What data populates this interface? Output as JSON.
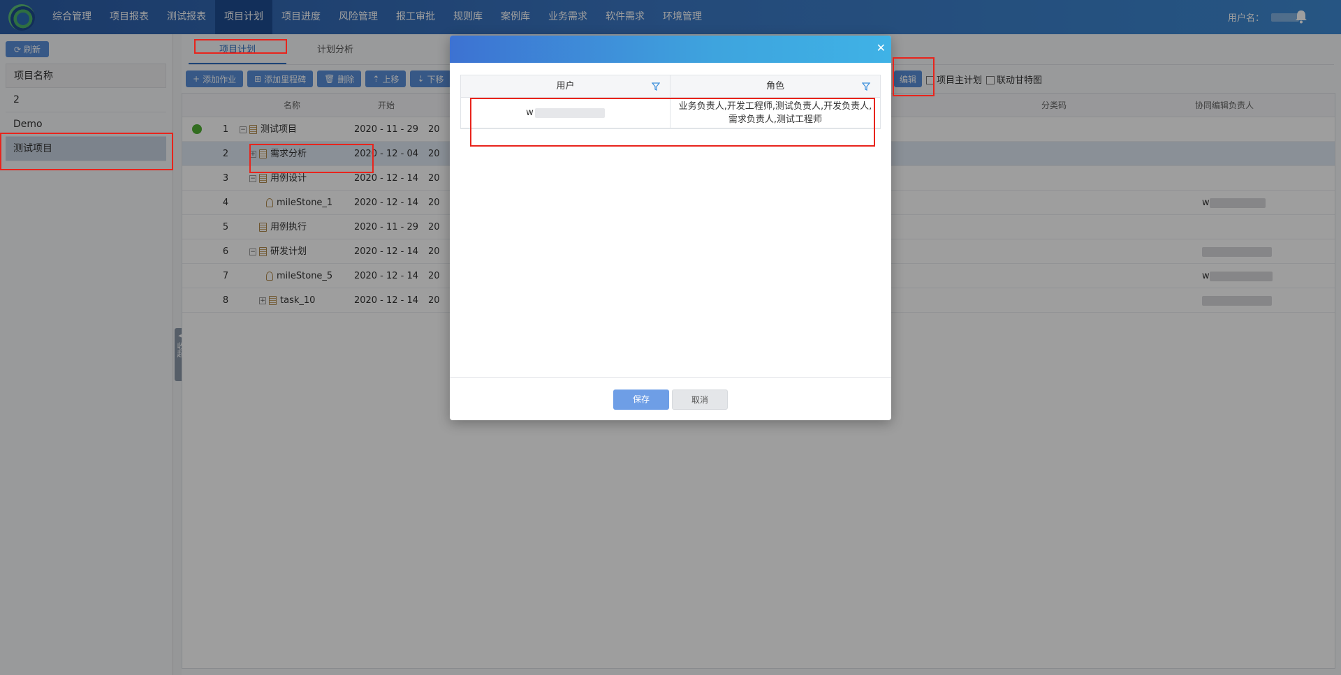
{
  "nav": {
    "items": [
      "综合管理",
      "项目报表",
      "测试报表",
      "项目计划",
      "项目进度",
      "风险管理",
      "报工审批",
      "规则库",
      "案例库",
      "业务需求",
      "软件需求",
      "环境管理"
    ],
    "active_index": 3,
    "user_label": "用户名："
  },
  "left": {
    "refresh_label": "刷新",
    "projects_header": "项目名称",
    "projects": [
      "2",
      "Demo",
      "测试项目"
    ],
    "collapse_label": "收起"
  },
  "tabs": [
    "项目计划",
    "计划分析"
  ],
  "toolbar": {
    "add_task": "添加作业",
    "add_milestone": "添加里程碑",
    "delete": "删除",
    "move_up": "上移",
    "move_down": "下移",
    "collab_edit": "编辑",
    "main_plan": "项目主计划",
    "link_gantt": "联动甘特图"
  },
  "grid": {
    "headers": {
      "name": "名称",
      "start": "开始",
      "code": "分类码",
      "assist": "协同编辑负责人"
    },
    "rows": [
      {
        "no": "1",
        "name": "测试项目",
        "start": "2020 - 11 - 29",
        "end": "20"
      },
      {
        "no": "2",
        "name": "需求分析",
        "start": "2020 - 12 - 04",
        "end": "20"
      },
      {
        "no": "3",
        "name": "用例设计",
        "start": "2020 - 12 - 14",
        "end": "20"
      },
      {
        "no": "4",
        "name": "mileStone_1",
        "start": "2020 - 12 - 14",
        "end": "20",
        "assist": "w"
      },
      {
        "no": "5",
        "name": "用例执行",
        "start": "2020 - 11 - 29",
        "end": "20"
      },
      {
        "no": "6",
        "name": "研发计划",
        "start": "2020 - 12 - 14",
        "end": "20"
      },
      {
        "no": "7",
        "name": "mileStone_5",
        "start": "2020 - 12 - 14",
        "end": "20",
        "assist": "w"
      },
      {
        "no": "8",
        "name": "task_10",
        "start": "2020 - 12 - 14",
        "end": "20"
      }
    ]
  },
  "modal": {
    "col_user": "用户",
    "col_role": "角色",
    "row_user": "w",
    "row_role": "业务负责人,开发工程师,测试负责人,开发负责人,需求负责人,测试工程师",
    "save": "保存",
    "cancel": "取消"
  },
  "colors": {
    "nav_bg": "#2c5ea8",
    "primary": "#5a8fd8",
    "annotation": "#e8241c",
    "status_green": "#52b135"
  }
}
